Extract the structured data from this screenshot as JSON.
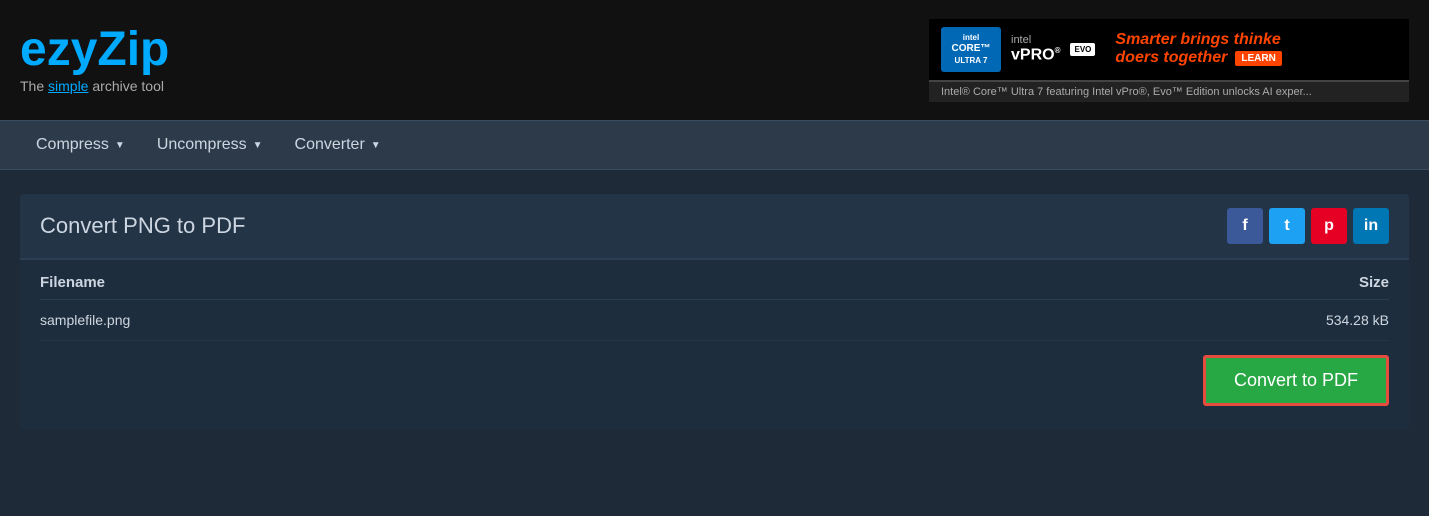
{
  "header": {
    "logo": {
      "prefix": "ezy",
      "highlight": "Zip",
      "tagline_plain": "The ",
      "tagline_simple": "simple",
      "tagline_rest": " archive tool"
    },
    "ad": {
      "intel_core": "intel\nCORE™\nULTRA 7",
      "intel_vpro": "intel\nvPRO",
      "evo": "EVO",
      "slogan_line1": "Smarter brings thinke",
      "slogan_line2": "doers together",
      "learn": "LEARN",
      "description": "Intel® Core™ Ultra 7 featuring Intel vPro®, Evo™ Edition unlocks AI exper..."
    }
  },
  "navbar": {
    "items": [
      {
        "label": "Compress",
        "has_arrow": true
      },
      {
        "label": "Uncompress",
        "has_arrow": true
      },
      {
        "label": "Converter",
        "has_arrow": true
      }
    ]
  },
  "card": {
    "title": "Convert PNG to PDF",
    "social": {
      "facebook": "f",
      "twitter": "t",
      "pinterest": "p",
      "linkedin": "in"
    },
    "table": {
      "col_filename": "Filename",
      "col_size": "Size",
      "files": [
        {
          "name": "samplefile.png",
          "size": "534.28 kB"
        }
      ]
    },
    "convert_button": "Convert to PDF"
  }
}
